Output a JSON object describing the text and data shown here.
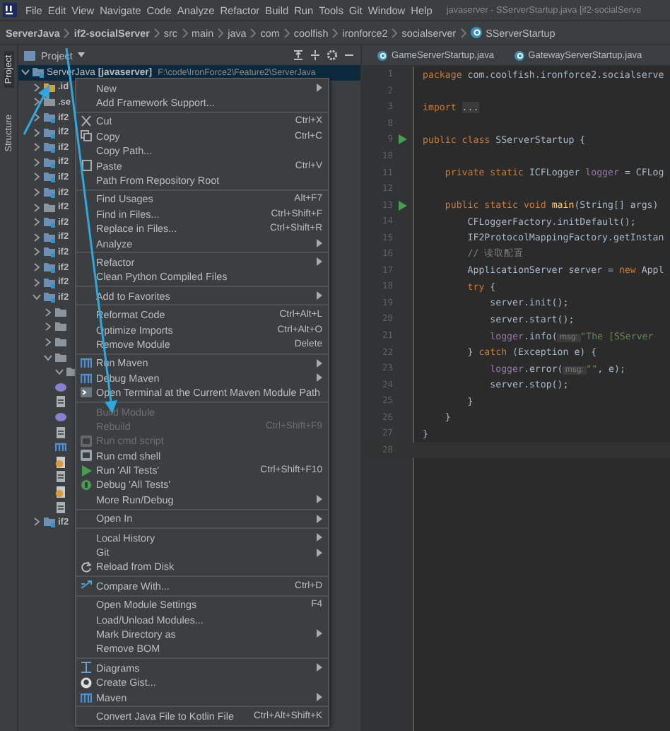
{
  "menu_bar": {
    "items": [
      "File",
      "Edit",
      "View",
      "Navigate",
      "Code",
      "Analyze",
      "Refactor",
      "Build",
      "Run",
      "Tools",
      "Git",
      "Window",
      "Help"
    ],
    "title": "javaserver - SServerStartup.java [if2-socialServe"
  },
  "breadcrumb": [
    "ServerJava",
    "if2-socialServer",
    "src",
    "main",
    "java",
    "com",
    "coolfish",
    "ironforce2",
    "socialserver",
    "SServerStartup"
  ],
  "tool_strip": [
    "Project",
    "Structure"
  ],
  "project_panel": {
    "title": "Project",
    "tree": {
      "label": "ServerJava",
      "module": "[javaserver]",
      "path": "F:\\code\\IronForce2\\Feature2\\ServerJava",
      "kind": "module",
      "expanded": true,
      "selected": true,
      "children": [
        {
          "label": ".id",
          "kind": "excluded",
          "expanded": false
        },
        {
          "label": ".se",
          "kind": "folder",
          "expanded": false
        },
        {
          "label": "if2",
          "kind": "module",
          "expanded": false
        },
        {
          "label": "if2",
          "kind": "module",
          "expanded": false
        },
        {
          "label": "if2",
          "kind": "module",
          "expanded": false
        },
        {
          "label": "if2",
          "kind": "module",
          "expanded": false
        },
        {
          "label": "if2",
          "kind": "module",
          "expanded": false
        },
        {
          "label": "if2",
          "kind": "module",
          "expanded": false
        },
        {
          "label": "if2",
          "kind": "folder",
          "expanded": false
        },
        {
          "label": "if2",
          "kind": "module",
          "expanded": false
        },
        {
          "label": "if2",
          "kind": "module",
          "expanded": false
        },
        {
          "label": "if2",
          "kind": "module",
          "expanded": false
        },
        {
          "label": "if2",
          "kind": "module",
          "expanded": false
        },
        {
          "label": "if2",
          "kind": "module",
          "expanded": false
        },
        {
          "label": "if2",
          "kind": "module",
          "expanded": true,
          "children": [
            {
              "kind": "folder",
              "expanded": false
            },
            {
              "kind": "folder",
              "expanded": false
            },
            {
              "kind": "folder",
              "expanded": false
            },
            {
              "kind": "folder",
              "expanded": true,
              "children": [
                {
                  "kind": "folder",
                  "expanded": true
                },
                {
                  "kind": "iml"
                },
                {
                  "kind": "file"
                },
                {
                  "kind": "iml"
                },
                {
                  "kind": "file"
                },
                {
                  "kind": "maven"
                },
                {
                  "kind": "config"
                },
                {
                  "kind": "file"
                },
                {
                  "kind": "config"
                },
                {
                  "kind": "file"
                }
              ]
            }
          ]
        },
        {
          "label": "if2",
          "kind": "module",
          "expanded": false
        }
      ]
    }
  },
  "editor": {
    "tabs": [
      {
        "label": "GameServerStartup.java",
        "selected": false
      },
      {
        "label": "GatewayServerStartup.java",
        "selected": false
      }
    ],
    "lines": [
      {
        "number": "1",
        "tokens": [
          {
            "kind": "kw",
            "text": "package "
          },
          {
            "kind": "plain",
            "text": "com.coolfish.ironforce2.socialserve"
          }
        ]
      },
      {
        "number": "2"
      },
      {
        "number": "3",
        "tokens": [
          {
            "kind": "kw",
            "text": "import "
          },
          {
            "kind": "fold",
            "text": "..."
          }
        ]
      },
      {
        "number": "8"
      },
      {
        "number": "9",
        "run": true,
        "tokens": [
          {
            "kind": "kw",
            "text": "public class "
          },
          {
            "kind": "plain",
            "text": "SServerStartup {"
          }
        ]
      },
      {
        "number": "10"
      },
      {
        "number": "11",
        "tokens": [
          {
            "kind": "kw",
            "text": "    private static "
          },
          {
            "kind": "plain",
            "text": "ICFLogger "
          },
          {
            "kind": "field",
            "text": "logger"
          },
          {
            "kind": "plain",
            "text": " = CFLog"
          }
        ]
      },
      {
        "number": "12"
      },
      {
        "number": "13",
        "run": true,
        "tokens": [
          {
            "kind": "kw",
            "text": "    public static void "
          },
          {
            "kind": "method",
            "text": "main"
          },
          {
            "kind": "plain",
            "text": "(String[] args)"
          }
        ]
      },
      {
        "number": "14",
        "tokens": [
          {
            "kind": "plain",
            "text": "        CFLoggerFactory.initDefault();"
          }
        ]
      },
      {
        "number": "15",
        "tokens": [
          {
            "kind": "plain",
            "text": "        IF2ProtocolMappingFactory.getInstan"
          }
        ]
      },
      {
        "number": "16",
        "tokens": [
          {
            "kind": "comment",
            "text": "        // 读取配置"
          }
        ]
      },
      {
        "number": "17",
        "tokens": [
          {
            "kind": "plain",
            "text": "        ApplicationServer server = "
          },
          {
            "kind": "kw",
            "text": "new "
          },
          {
            "kind": "plain",
            "text": "Appl"
          }
        ]
      },
      {
        "number": "18",
        "tokens": [
          {
            "kind": "kw",
            "text": "        try "
          },
          {
            "kind": "plain",
            "text": "{"
          }
        ]
      },
      {
        "number": "19",
        "tokens": [
          {
            "kind": "plain",
            "text": "            server.init();"
          }
        ]
      },
      {
        "number": "20",
        "tokens": [
          {
            "kind": "plain",
            "text": "            server.start();"
          }
        ]
      },
      {
        "number": "21",
        "tokens": [
          {
            "kind": "field",
            "text": "            logger"
          },
          {
            "kind": "plain",
            "text": ".info("
          },
          {
            "kind": "hint",
            "text": " msg: "
          },
          {
            "kind": "string",
            "text": "\"The [SServer"
          }
        ]
      },
      {
        "number": "22",
        "tokens": [
          {
            "kind": "plain",
            "text": "        } "
          },
          {
            "kind": "kw",
            "text": "catch "
          },
          {
            "kind": "plain",
            "text": "(Exception e) {"
          }
        ]
      },
      {
        "number": "23",
        "tokens": [
          {
            "kind": "field",
            "text": "            logger"
          },
          {
            "kind": "plain",
            "text": ".error("
          },
          {
            "kind": "hint",
            "text": " msg: "
          },
          {
            "kind": "string",
            "text": "\"\""
          },
          {
            "kind": "plain",
            "text": ", e);"
          }
        ]
      },
      {
        "number": "24",
        "tokens": [
          {
            "kind": "plain",
            "text": "            server.stop();"
          }
        ]
      },
      {
        "number": "25",
        "tokens": [
          {
            "kind": "plain",
            "text": "        }"
          }
        ]
      },
      {
        "number": "26",
        "tokens": [
          {
            "kind": "plain",
            "text": "    }"
          }
        ]
      },
      {
        "number": "27",
        "tokens": [
          {
            "kind": "plain",
            "text": "}"
          }
        ]
      },
      {
        "number": "28"
      }
    ]
  },
  "context_menu": {
    "items": [
      {
        "kind": "item",
        "label": "New",
        "submenu": true,
        "disabled": false
      },
      {
        "kind": "item",
        "label": "Add Framework Support...",
        "disabled": false
      },
      {
        "kind": "separator"
      },
      {
        "kind": "item",
        "label": "Cut",
        "shortcut": "Ctrl+X",
        "disabled": false
      },
      {
        "kind": "item",
        "label": "Copy",
        "shortcut": "Ctrl+C",
        "disabled": false
      },
      {
        "kind": "item",
        "label": "Copy Path...",
        "disabled": false
      },
      {
        "kind": "item",
        "label": "Paste",
        "shortcut": "Ctrl+V",
        "disabled": false
      },
      {
        "kind": "item",
        "label": "Path From Repository Root",
        "disabled": false
      },
      {
        "kind": "separator"
      },
      {
        "kind": "item",
        "label": "Find Usages",
        "shortcut": "Alt+F7",
        "disabled": false
      },
      {
        "kind": "item",
        "label": "Find in Files...",
        "shortcut": "Ctrl+Shift+F",
        "disabled": false
      },
      {
        "kind": "item",
        "label": "Replace in Files...",
        "shortcut": "Ctrl+Shift+R",
        "disabled": false
      },
      {
        "kind": "item",
        "label": "Analyze",
        "submenu": true,
        "disabled": false
      },
      {
        "kind": "separator"
      },
      {
        "kind": "item",
        "label": "Refactor",
        "submenu": true,
        "disabled": false
      },
      {
        "kind": "item",
        "label": "Clean Python Compiled Files",
        "disabled": false
      },
      {
        "kind": "separator"
      },
      {
        "kind": "item",
        "label": "Add to Favorites",
        "submenu": true,
        "disabled": false
      },
      {
        "kind": "separator"
      },
      {
        "kind": "item",
        "label": "Reformat Code",
        "shortcut": "Ctrl+Alt+L",
        "disabled": false
      },
      {
        "kind": "item",
        "label": "Optimize Imports",
        "shortcut": "Ctrl+Alt+O",
        "disabled": false
      },
      {
        "kind": "item",
        "label": "Remove Module",
        "shortcut": "Delete",
        "disabled": false
      },
      {
        "kind": "separator"
      },
      {
        "kind": "item",
        "label": "Run Maven",
        "submenu": true,
        "disabled": false
      },
      {
        "kind": "item",
        "label": "Debug Maven",
        "submenu": true,
        "disabled": false
      },
      {
        "kind": "item",
        "label": "Open Terminal at the Current Maven Module Path",
        "disabled": false
      },
      {
        "kind": "separator"
      },
      {
        "kind": "item",
        "label": "Build Module",
        "disabled": true
      },
      {
        "kind": "item",
        "label": "Rebuild",
        "shortcut": "Ctrl+Shift+F9",
        "disabled": true
      },
      {
        "kind": "item",
        "label": "Run cmd script",
        "disabled": true
      },
      {
        "kind": "item",
        "label": "Run cmd shell",
        "disabled": false
      },
      {
        "kind": "item",
        "label": "Run 'All Tests'",
        "shortcut": "Ctrl+Shift+F10",
        "disabled": false
      },
      {
        "kind": "item",
        "label": "Debug 'All Tests'",
        "disabled": false
      },
      {
        "kind": "item",
        "label": "More Run/Debug",
        "submenu": true,
        "disabled": false
      },
      {
        "kind": "separator"
      },
      {
        "kind": "item",
        "label": "Open In",
        "submenu": true,
        "disabled": false
      },
      {
        "kind": "separator"
      },
      {
        "kind": "item",
        "label": "Local History",
        "submenu": true,
        "disabled": false
      },
      {
        "kind": "item",
        "label": "Git",
        "submenu": true,
        "disabled": false
      },
      {
        "kind": "item",
        "label": "Reload from Disk",
        "disabled": false
      },
      {
        "kind": "separator"
      },
      {
        "kind": "item",
        "label": "Compare With...",
        "shortcut": "Ctrl+D",
        "disabled": false
      },
      {
        "kind": "separator"
      },
      {
        "kind": "item",
        "label": "Open Module Settings",
        "shortcut": "F4",
        "disabled": false
      },
      {
        "kind": "item",
        "label": "Load/Unload Modules...",
        "disabled": false
      },
      {
        "kind": "item",
        "label": "Mark Directory as",
        "submenu": true,
        "disabled": false
      },
      {
        "kind": "item",
        "label": "Remove BOM",
        "disabled": false
      },
      {
        "kind": "separator"
      },
      {
        "kind": "item",
        "label": "Diagrams",
        "submenu": true,
        "disabled": false
      },
      {
        "kind": "item",
        "label": "Create Gist...",
        "disabled": false
      },
      {
        "kind": "item",
        "label": "Maven",
        "submenu": true,
        "disabled": false
      },
      {
        "kind": "separator"
      },
      {
        "kind": "item",
        "label": "Convert Java File to Kotlin File",
        "shortcut": "Ctrl+Alt+Shift+K",
        "disabled": false
      }
    ]
  }
}
